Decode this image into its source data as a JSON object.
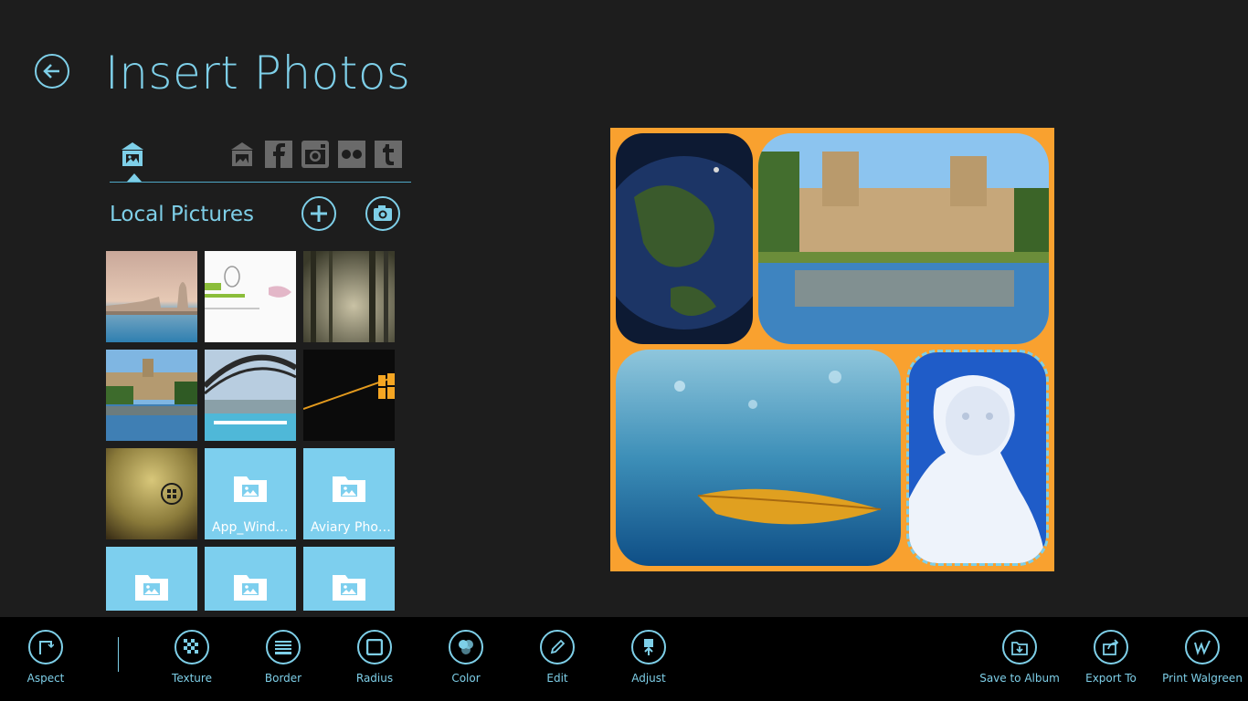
{
  "header": {
    "title": "Insert Photos"
  },
  "sources": {
    "active": "local-pictures-icon",
    "items": [
      "local-pictures-icon",
      "skydrive-icon",
      "facebook-icon",
      "instagram-icon",
      "flickr-icon",
      "tumblr-icon"
    ]
  },
  "local": {
    "label": "Local Pictures"
  },
  "folders": {
    "f1": "App_Wind…",
    "f2": "Aviary Pho…"
  },
  "toolbar": {
    "aspect": "Aspect",
    "texture": "Texture",
    "border": "Border",
    "radius": "Radius",
    "color": "Color",
    "edit": "Edit",
    "adjust": "Adjust",
    "save": "Save to Album",
    "export": "Export To",
    "print": "Print Walgreen"
  },
  "colors": {
    "accent": "#7ecfe8",
    "background": "#1d1d1d",
    "collage_background": "#f9a12f",
    "folder_tile": "#7dcfee",
    "bottom_bar": "#000000"
  }
}
